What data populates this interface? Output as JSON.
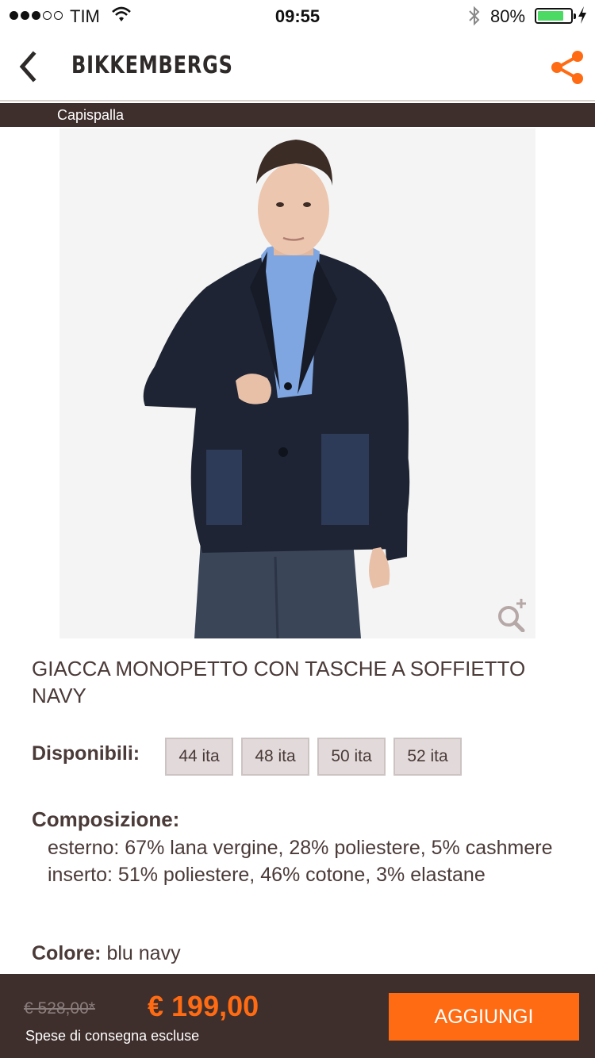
{
  "status_bar": {
    "carrier": "TIM",
    "signal_bars_filled": 3,
    "signal_bars_total": 5,
    "time": "09:55",
    "battery_pct": "80%",
    "battery_level": 0.8,
    "battery_color": "#4cd964"
  },
  "nav": {
    "brand": "BIKKEMBERGS",
    "back_icon": "chevron-left-icon",
    "share_icon": "share-icon",
    "accent_color": "#ff6b13"
  },
  "category": {
    "label": "Capispalla"
  },
  "product": {
    "title": "GIACCA MONOPETTO CON TASCHE A SOFFIETTO NAVY",
    "zoom_icon": "zoom-in-icon",
    "available_label": "Disponibili:",
    "sizes": [
      "44 ita",
      "48 ita",
      "50 ita",
      "52 ita"
    ],
    "composition_label": "Composizione:",
    "composition_lines": [
      "esterno: 67% lana vergine, 28% poliestere, 5% cashmere",
      "inserto: 51% poliestere, 46% cotone, 3% elastane"
    ],
    "color_label": "Colore:",
    "color_value": "blu navy"
  },
  "bottom_bar": {
    "old_price": "€ 528,00*",
    "new_price": "€ 199,00",
    "shipping_note": "Spese di consegna escluse",
    "add_button_label": "AGGIUNGI"
  }
}
